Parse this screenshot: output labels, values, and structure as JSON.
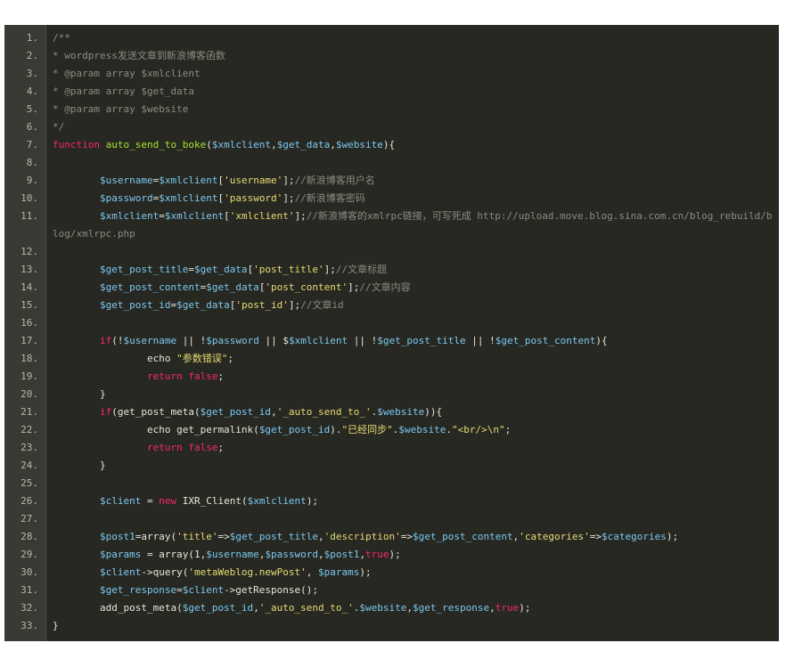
{
  "theme": {
    "background": "#272822",
    "gutter_background": "#3a3a35",
    "line_number_color": "#b7b7a8",
    "comment_color": "#8c8c84",
    "keyword_color": "#f92672",
    "function_color": "#a6e22e",
    "variable_color": "#7cc8f0",
    "string_color": "#e6db74",
    "text_color": "#e6e6dc"
  },
  "lines": [
    {
      "number": "1.",
      "tokens": [
        {
          "t": "comment",
          "v": "/**"
        }
      ]
    },
    {
      "number": "2.",
      "tokens": [
        {
          "t": "comment",
          "v": "* wordpress发送文章到新浪博客函数"
        }
      ]
    },
    {
      "number": "3.",
      "tokens": [
        {
          "t": "comment",
          "v": "* @param array $xmlclient"
        }
      ]
    },
    {
      "number": "4.",
      "tokens": [
        {
          "t": "comment",
          "v": "* @param array $get_data"
        }
      ]
    },
    {
      "number": "5.",
      "tokens": [
        {
          "t": "comment",
          "v": "* @param array $website"
        }
      ]
    },
    {
      "number": "6.",
      "tokens": [
        {
          "t": "comment",
          "v": "*/"
        }
      ]
    },
    {
      "number": "7.",
      "tokens": [
        {
          "t": "keyword",
          "v": "function"
        },
        {
          "t": "plain",
          "v": " "
        },
        {
          "t": "func",
          "v": "auto_send_to_boke"
        },
        {
          "t": "plain",
          "v": "("
        },
        {
          "t": "var",
          "v": "$xmlclient"
        },
        {
          "t": "plain",
          "v": ","
        },
        {
          "t": "var",
          "v": "$get_data"
        },
        {
          "t": "plain",
          "v": ","
        },
        {
          "t": "var",
          "v": "$website"
        },
        {
          "t": "plain",
          "v": "){"
        }
      ]
    },
    {
      "number": "8.",
      "tokens": []
    },
    {
      "number": "9.",
      "tokens": [
        {
          "t": "plain",
          "v": "        "
        },
        {
          "t": "var",
          "v": "$username"
        },
        {
          "t": "plain",
          "v": "="
        },
        {
          "t": "var",
          "v": "$xmlclient"
        },
        {
          "t": "plain",
          "v": "["
        },
        {
          "t": "string",
          "v": "'username'"
        },
        {
          "t": "plain",
          "v": "];"
        },
        {
          "t": "comment",
          "v": "//新浪博客用户名"
        }
      ]
    },
    {
      "number": "10.",
      "tokens": [
        {
          "t": "plain",
          "v": "        "
        },
        {
          "t": "var",
          "v": "$password"
        },
        {
          "t": "plain",
          "v": "="
        },
        {
          "t": "var",
          "v": "$xmlclient"
        },
        {
          "t": "plain",
          "v": "["
        },
        {
          "t": "string",
          "v": "'password'"
        },
        {
          "t": "plain",
          "v": "];"
        },
        {
          "t": "comment",
          "v": "//新浪博客密码"
        }
      ]
    },
    {
      "number": "11.",
      "wrapped": true,
      "tokens": [
        {
          "t": "plain",
          "v": "        "
        },
        {
          "t": "var",
          "v": "$xmlclient"
        },
        {
          "t": "plain",
          "v": "="
        },
        {
          "t": "var",
          "v": "$xmlclient"
        },
        {
          "t": "plain",
          "v": "["
        },
        {
          "t": "string",
          "v": "'xmlclient'"
        },
        {
          "t": "plain",
          "v": "];"
        },
        {
          "t": "comment",
          "v": "//新浪博客的xmlrpc链接，可写死成 http://upload.move.blog.sina.com.cn/blog_rebuild/blog/xmlrpc.php"
        }
      ]
    },
    {
      "number": "12.",
      "tokens": []
    },
    {
      "number": "13.",
      "tokens": [
        {
          "t": "plain",
          "v": "        "
        },
        {
          "t": "var",
          "v": "$get_post_title"
        },
        {
          "t": "plain",
          "v": "="
        },
        {
          "t": "var",
          "v": "$get_data"
        },
        {
          "t": "plain",
          "v": "["
        },
        {
          "t": "string",
          "v": "'post_title'"
        },
        {
          "t": "plain",
          "v": "];"
        },
        {
          "t": "comment",
          "v": "//文章标题"
        }
      ]
    },
    {
      "number": "14.",
      "tokens": [
        {
          "t": "plain",
          "v": "        "
        },
        {
          "t": "var",
          "v": "$get_post_content"
        },
        {
          "t": "plain",
          "v": "="
        },
        {
          "t": "var",
          "v": "$get_data"
        },
        {
          "t": "plain",
          "v": "["
        },
        {
          "t": "string",
          "v": "'post_content'"
        },
        {
          "t": "plain",
          "v": "];"
        },
        {
          "t": "comment",
          "v": "//文章内容"
        }
      ]
    },
    {
      "number": "15.",
      "tokens": [
        {
          "t": "plain",
          "v": "        "
        },
        {
          "t": "var",
          "v": "$get_post_id"
        },
        {
          "t": "plain",
          "v": "="
        },
        {
          "t": "var",
          "v": "$get_data"
        },
        {
          "t": "plain",
          "v": "["
        },
        {
          "t": "string",
          "v": "'post_id'"
        },
        {
          "t": "plain",
          "v": "];"
        },
        {
          "t": "comment",
          "v": "//文章id"
        }
      ]
    },
    {
      "number": "16.",
      "tokens": []
    },
    {
      "number": "17.",
      "tokens": [
        {
          "t": "plain",
          "v": "        "
        },
        {
          "t": "keyword",
          "v": "if"
        },
        {
          "t": "plain",
          "v": "(!"
        },
        {
          "t": "var",
          "v": "$username"
        },
        {
          "t": "plain",
          "v": " || !"
        },
        {
          "t": "var",
          "v": "$password"
        },
        {
          "t": "plain",
          "v": " || $"
        },
        {
          "t": "var",
          "v": "$xmlclient"
        },
        {
          "t": "plain",
          "v": " || !"
        },
        {
          "t": "var",
          "v": "$get_post_title"
        },
        {
          "t": "plain",
          "v": " || !"
        },
        {
          "t": "var",
          "v": "$get_post_content"
        },
        {
          "t": "plain",
          "v": "){"
        }
      ]
    },
    {
      "number": "18.",
      "tokens": [
        {
          "t": "plain",
          "v": "                echo "
        },
        {
          "t": "string",
          "v": "\"参数错误\""
        },
        {
          "t": "plain",
          "v": ";"
        }
      ]
    },
    {
      "number": "19.",
      "tokens": [
        {
          "t": "plain",
          "v": "                "
        },
        {
          "t": "keyword",
          "v": "return"
        },
        {
          "t": "plain",
          "v": " "
        },
        {
          "t": "keyword",
          "v": "false"
        },
        {
          "t": "plain",
          "v": ";"
        }
      ]
    },
    {
      "number": "20.",
      "tokens": [
        {
          "t": "plain",
          "v": "        }"
        }
      ]
    },
    {
      "number": "21.",
      "tokens": [
        {
          "t": "plain",
          "v": "        "
        },
        {
          "t": "keyword",
          "v": "if"
        },
        {
          "t": "plain",
          "v": "(get_post_meta("
        },
        {
          "t": "var",
          "v": "$get_post_id"
        },
        {
          "t": "plain",
          "v": ","
        },
        {
          "t": "string",
          "v": "'_auto_send_to_'"
        },
        {
          "t": "plain",
          "v": "."
        },
        {
          "t": "var",
          "v": "$website"
        },
        {
          "t": "plain",
          "v": ")){"
        }
      ]
    },
    {
      "number": "22.",
      "tokens": [
        {
          "t": "plain",
          "v": "                echo get_permalink("
        },
        {
          "t": "var",
          "v": "$get_post_id"
        },
        {
          "t": "plain",
          "v": ")."
        },
        {
          "t": "string",
          "v": "\"已经同步\""
        },
        {
          "t": "plain",
          "v": "."
        },
        {
          "t": "var",
          "v": "$website"
        },
        {
          "t": "plain",
          "v": "."
        },
        {
          "t": "string",
          "v": "\"<br/>\\n\""
        },
        {
          "t": "plain",
          "v": ";"
        }
      ]
    },
    {
      "number": "23.",
      "tokens": [
        {
          "t": "plain",
          "v": "                "
        },
        {
          "t": "keyword",
          "v": "return"
        },
        {
          "t": "plain",
          "v": " "
        },
        {
          "t": "keyword",
          "v": "false"
        },
        {
          "t": "plain",
          "v": ";"
        }
      ]
    },
    {
      "number": "24.",
      "tokens": [
        {
          "t": "plain",
          "v": "        }"
        }
      ]
    },
    {
      "number": "25.",
      "tokens": []
    },
    {
      "number": "26.",
      "tokens": [
        {
          "t": "plain",
          "v": "        "
        },
        {
          "t": "var",
          "v": "$client"
        },
        {
          "t": "plain",
          "v": " = "
        },
        {
          "t": "keyword",
          "v": "new"
        },
        {
          "t": "plain",
          "v": " IXR_Client("
        },
        {
          "t": "var",
          "v": "$xmlclient"
        },
        {
          "t": "plain",
          "v": ");"
        }
      ]
    },
    {
      "number": "27.",
      "tokens": []
    },
    {
      "number": "28.",
      "tokens": [
        {
          "t": "plain",
          "v": "        "
        },
        {
          "t": "var",
          "v": "$post1"
        },
        {
          "t": "plain",
          "v": "=array("
        },
        {
          "t": "string",
          "v": "'title'"
        },
        {
          "t": "plain",
          "v": "=>"
        },
        {
          "t": "var",
          "v": "$get_post_title"
        },
        {
          "t": "plain",
          "v": ","
        },
        {
          "t": "string",
          "v": "'description'"
        },
        {
          "t": "plain",
          "v": "=>"
        },
        {
          "t": "var",
          "v": "$get_post_content"
        },
        {
          "t": "plain",
          "v": ","
        },
        {
          "t": "string",
          "v": "'categories'"
        },
        {
          "t": "plain",
          "v": "=>"
        },
        {
          "t": "var",
          "v": "$categories"
        },
        {
          "t": "plain",
          "v": ");"
        }
      ]
    },
    {
      "number": "29.",
      "tokens": [
        {
          "t": "plain",
          "v": "        "
        },
        {
          "t": "var",
          "v": "$params"
        },
        {
          "t": "plain",
          "v": " = array(1,"
        },
        {
          "t": "var",
          "v": "$username"
        },
        {
          "t": "plain",
          "v": ","
        },
        {
          "t": "var",
          "v": "$password"
        },
        {
          "t": "plain",
          "v": ","
        },
        {
          "t": "var",
          "v": "$post1"
        },
        {
          "t": "plain",
          "v": ","
        },
        {
          "t": "keyword",
          "v": "true"
        },
        {
          "t": "plain",
          "v": ");"
        }
      ]
    },
    {
      "number": "30.",
      "tokens": [
        {
          "t": "plain",
          "v": "        "
        },
        {
          "t": "var",
          "v": "$client"
        },
        {
          "t": "plain",
          "v": "->query("
        },
        {
          "t": "string",
          "v": "'metaWeblog.newPost'"
        },
        {
          "t": "plain",
          "v": ", "
        },
        {
          "t": "var",
          "v": "$params"
        },
        {
          "t": "plain",
          "v": ");"
        }
      ]
    },
    {
      "number": "31.",
      "tokens": [
        {
          "t": "plain",
          "v": "        "
        },
        {
          "t": "var",
          "v": "$get_response"
        },
        {
          "t": "plain",
          "v": "="
        },
        {
          "t": "var",
          "v": "$client"
        },
        {
          "t": "plain",
          "v": "->getResponse();"
        }
      ]
    },
    {
      "number": "32.",
      "tokens": [
        {
          "t": "plain",
          "v": "        add_post_meta("
        },
        {
          "t": "var",
          "v": "$get_post_id"
        },
        {
          "t": "plain",
          "v": ","
        },
        {
          "t": "string",
          "v": "'_auto_send_to_'"
        },
        {
          "t": "plain",
          "v": "."
        },
        {
          "t": "var",
          "v": "$website"
        },
        {
          "t": "plain",
          "v": ","
        },
        {
          "t": "var",
          "v": "$get_response"
        },
        {
          "t": "plain",
          "v": ","
        },
        {
          "t": "keyword",
          "v": "true"
        },
        {
          "t": "plain",
          "v": ");"
        }
      ]
    },
    {
      "number": "33.",
      "tokens": [
        {
          "t": "plain",
          "v": "}"
        }
      ]
    }
  ]
}
